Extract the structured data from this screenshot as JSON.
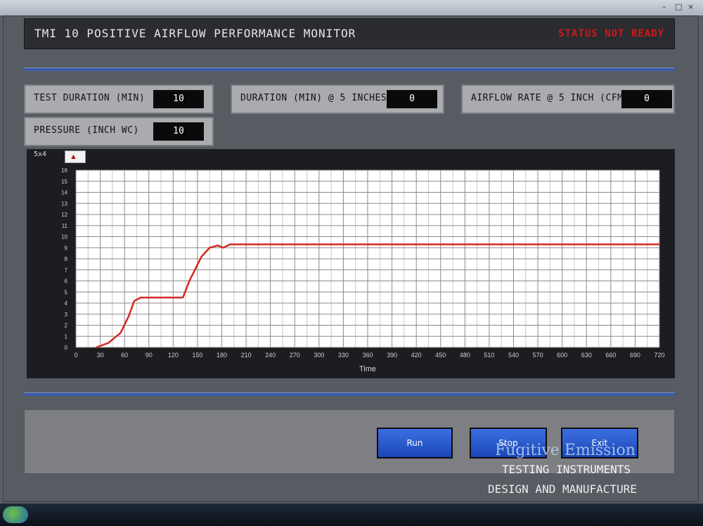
{
  "window": {
    "title": "TMI 10 POSITIVE AIRFLOW PERFORMANCE MONITOR",
    "status": "STATUS NOT READY"
  },
  "params": [
    {
      "label": "TEST DURATION (MIN)",
      "value": "10"
    },
    {
      "label": "DURATION (MIN) @ 5 INCHES",
      "value": "0"
    },
    {
      "label": "AIRFLOW RATE @ 5 INCH (CFM)",
      "value": "0"
    },
    {
      "label": "PRESSURE (INCH WC)",
      "value": "10"
    }
  ],
  "chart_tab": {
    "label": "5x4"
  },
  "chart_data": {
    "type": "line",
    "xlabel": "Time",
    "ylabel": "",
    "x_ticks": [
      "0",
      "30",
      "60",
      "90",
      "120",
      "150",
      "180",
      "210",
      "240",
      "270",
      "300",
      "330",
      "360",
      "390",
      "420",
      "450",
      "480",
      "510",
      "540",
      "570",
      "600",
      "630",
      "660",
      "690",
      "720"
    ],
    "y_ticks": [
      "0",
      "1",
      "2",
      "3",
      "4",
      "5",
      "6",
      "7",
      "8",
      "9",
      "10",
      "11",
      "12",
      "13",
      "14",
      "15",
      "16"
    ],
    "xlim": [
      0,
      720
    ],
    "ylim": [
      0,
      16
    ],
    "grid": true,
    "series": [
      {
        "color": "#d42a22",
        "x": [
          25,
          40,
          55,
          65,
          72,
          80,
          90,
          100,
          130,
          132,
          140,
          155,
          165,
          175,
          182,
          190,
          215,
          230,
          240,
          720
        ],
        "y": [
          0,
          0.4,
          1.3,
          2.8,
          4.2,
          4.5,
          4.5,
          4.5,
          4.5,
          4.5,
          6.0,
          8.2,
          9.0,
          9.2,
          9.0,
          9.3,
          9.3,
          9.3,
          9.3,
          9.3
        ]
      }
    ]
  },
  "buttons": {
    "run": "Run",
    "stop": "Stop",
    "exit": "Exit"
  },
  "watermark": {
    "line1": "Fugitive Emission",
    "line2": "TESTING INSTRUMENTS",
    "line3": "DESIGN AND MANUFACTURE"
  }
}
